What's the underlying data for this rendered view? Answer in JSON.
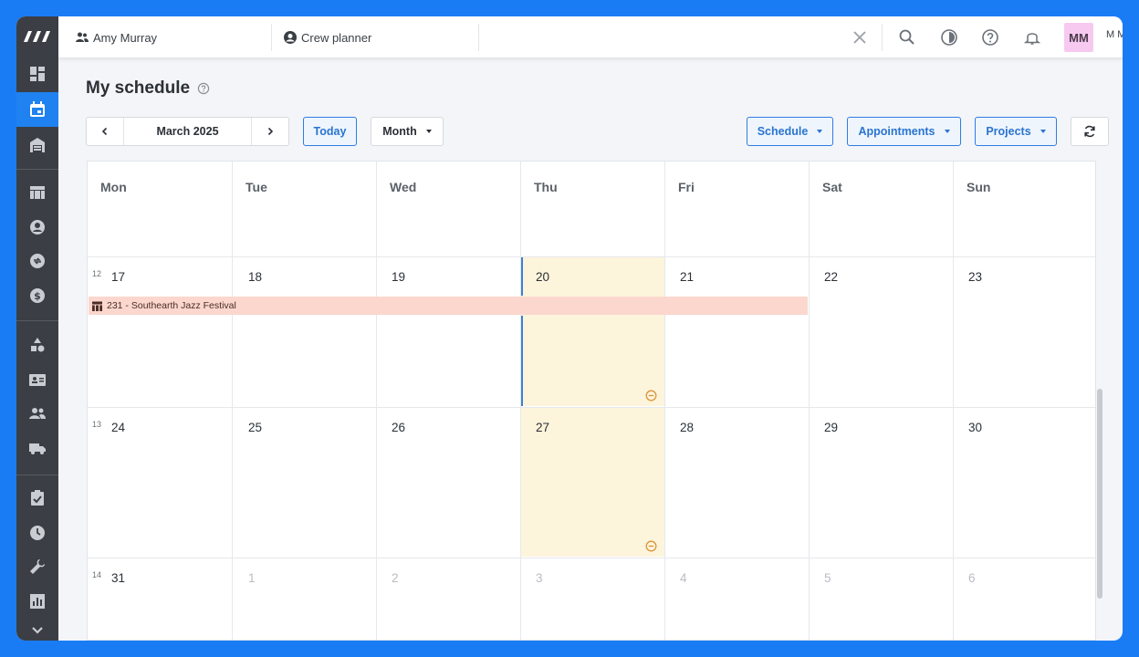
{
  "colors": {
    "brand_blue": "#1a7cf5",
    "sidebar": "#3b3f45",
    "today_bg": "#fdf4dc",
    "event_bg": "#fcd7cd",
    "avatar_bg": "#f7c9f1"
  },
  "topbar": {
    "user_label": "Amy Murray",
    "planner_label": "Crew planner",
    "avatar_initials": "MM",
    "user_name_short": "M M"
  },
  "page": {
    "title": "My schedule"
  },
  "toolbar": {
    "month_label": "March 2025",
    "today_label": "Today",
    "view_label": "Month",
    "schedule_label": "Schedule",
    "appointments_label": "Appointments",
    "projects_label": "Projects"
  },
  "calendar": {
    "day_names": [
      "Mon",
      "Tue",
      "Wed",
      "Thu",
      "Fri",
      "Sat",
      "Sun"
    ],
    "weeks": [
      {
        "week": "12",
        "days": [
          "17",
          "18",
          "19",
          "20",
          "21",
          "22",
          "23"
        ]
      },
      {
        "week": "13",
        "days": [
          "24",
          "25",
          "26",
          "27",
          "28",
          "29",
          "30"
        ]
      },
      {
        "week": "14",
        "days": [
          "31",
          "1",
          "2",
          "3",
          "4",
          "5",
          "6"
        ]
      }
    ],
    "event": {
      "label": "231 - Southearth Jazz Festival"
    }
  },
  "sidebar_icons": [
    "logo-icon",
    "dashboard-icon",
    "calendar-icon",
    "warehouse-icon",
    "table-icon",
    "account-icon",
    "sync-icon",
    "money-icon",
    "shapes-icon",
    "contact-card-icon",
    "people-icon",
    "truck-icon",
    "clipboard-check-icon",
    "clock-icon",
    "wrench-icon",
    "chart-icon",
    "chevron-down-icon"
  ]
}
